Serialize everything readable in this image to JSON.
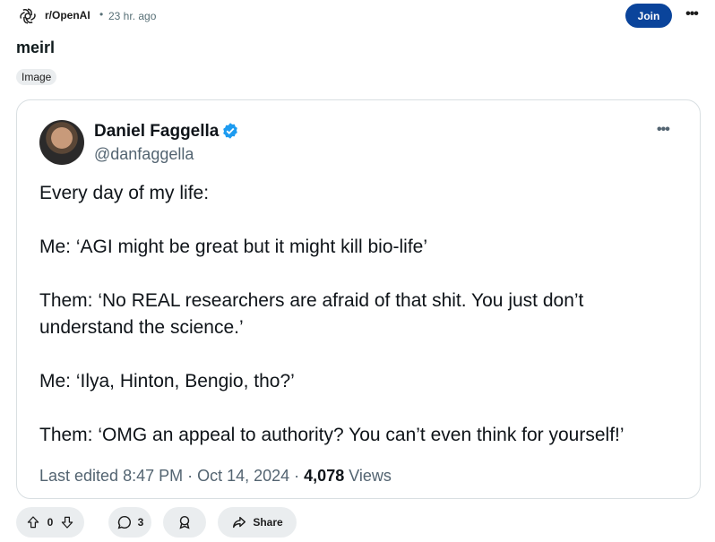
{
  "header": {
    "subreddit": "r/OpenAI",
    "separator": "•",
    "time": "23 hr. ago",
    "join_label": "Join",
    "more_label": "•••"
  },
  "post": {
    "title": "meirl",
    "flair": "Image"
  },
  "tweet": {
    "author_name": "Daniel Faggella",
    "handle": "@danfaggella",
    "more_label": "•••",
    "lines": [
      "Every day of my life:",
      "Me: ‘AGI might be great but it might kill bio-life’",
      "Them: ‘No REAL researchers are afraid of that shit. You just don’t",
      "understand the science.’",
      "Me: ‘Ilya, Hinton, Bengio, tho?’",
      "Them: ‘OMG an appeal to authority? You can’t even think for yourself!’"
    ],
    "meta_prefix": "Last edited 8:47 PM · Oct 14, 2024 · ",
    "views_count": "4,078",
    "views_label": " Views"
  },
  "actions": {
    "votes": "0",
    "comments": "3",
    "share_label": "Share"
  },
  "colors": {
    "join_bg": "#0a449b",
    "verified": "#1d9bf0",
    "pill_bg": "#eaedef"
  }
}
